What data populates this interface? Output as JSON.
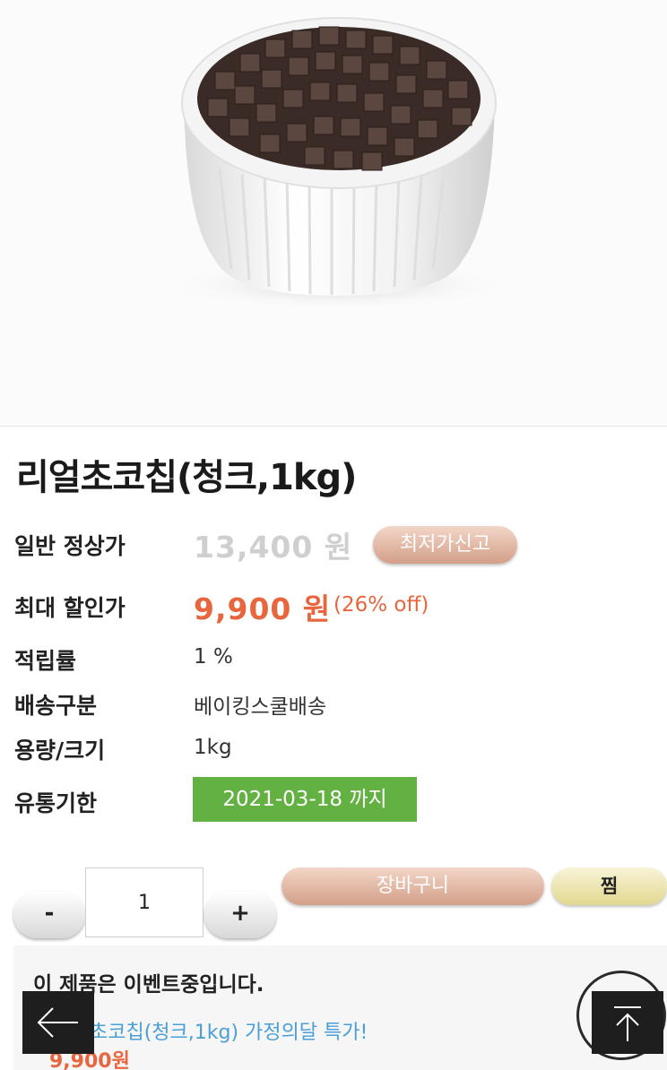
{
  "product": {
    "image_alt": "chocolate chunks in white ramekin",
    "title": "리얼초코칩(청크,1kg)"
  },
  "info": {
    "normal_price_label": "일반 정상가",
    "normal_price": "13,400 원",
    "report_button": "최저가신고",
    "sale_price_label": "최대 할인가",
    "sale_price": "9,900 원",
    "discount": "(26% off)",
    "points_label": "적립률",
    "points": "1 %",
    "shipping_label": "배송구분",
    "shipping": "베이킹스쿨배송",
    "size_label": "용량/크기",
    "size": "1kg",
    "expiry_label": "유통기한",
    "expiry": "2021-03-18 까지"
  },
  "purchase": {
    "minus_label": "-",
    "quantity": "1",
    "plus_label": "+",
    "cart_button": "장바구니",
    "wish_button": "찜"
  },
  "event": {
    "title": "이 제품은 이벤트중입니다.",
    "link_text": "초코칩(청크,1kg) 가정의달 특가!",
    "price": "9,900원"
  },
  "colors": {
    "sale": "#e8663d",
    "expiry_bg": "#63b043",
    "link": "#4a9fd6"
  },
  "icons": {
    "back": "arrow-left-icon",
    "top": "arrow-up-icon"
  }
}
